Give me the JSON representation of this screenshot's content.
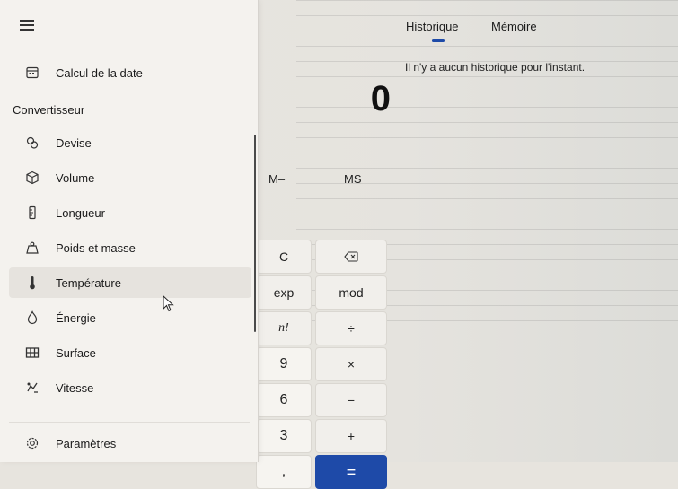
{
  "header": {
    "menu_icon": "hamburger-icon"
  },
  "sidebar": {
    "date_item": {
      "label": "Calcul de la date",
      "icon": "calendar-icon"
    },
    "section_title": "Convertisseur",
    "items": [
      {
        "label": "Devise",
        "icon": "currency-icon"
      },
      {
        "label": "Volume",
        "icon": "volume-cube-icon"
      },
      {
        "label": "Longueur",
        "icon": "ruler-icon"
      },
      {
        "label": "Poids et masse",
        "icon": "weight-icon"
      },
      {
        "label": "Température",
        "icon": "thermometer-icon"
      },
      {
        "label": "Énergie",
        "icon": "energy-icon"
      },
      {
        "label": "Surface",
        "icon": "area-grid-icon"
      },
      {
        "label": "Vitesse",
        "icon": "speed-icon"
      }
    ],
    "settings": {
      "label": "Paramètres",
      "icon": "gear-icon"
    }
  },
  "calculator": {
    "display": "0",
    "memory": {
      "subtract": "M–",
      "store": "MS"
    },
    "keys": {
      "clear": "C",
      "backspace_icon": "backspace-icon",
      "exp": "exp",
      "mod": "mod",
      "factorial": "n!",
      "divide": "÷",
      "nine": "9",
      "multiply": "×",
      "six": "6",
      "minus": "−",
      "three": "3",
      "plus": "+",
      "decimal": ",",
      "equals": "="
    }
  },
  "history_panel": {
    "tabs": [
      "Historique",
      "Mémoire"
    ],
    "active_tab": "Historique",
    "empty_message": "Il n'y a aucun historique pour l'instant."
  },
  "colors": {
    "accent": "#1e4aa8",
    "nav_background": "#f4f2ee",
    "selected_item": "#e6e3de"
  }
}
